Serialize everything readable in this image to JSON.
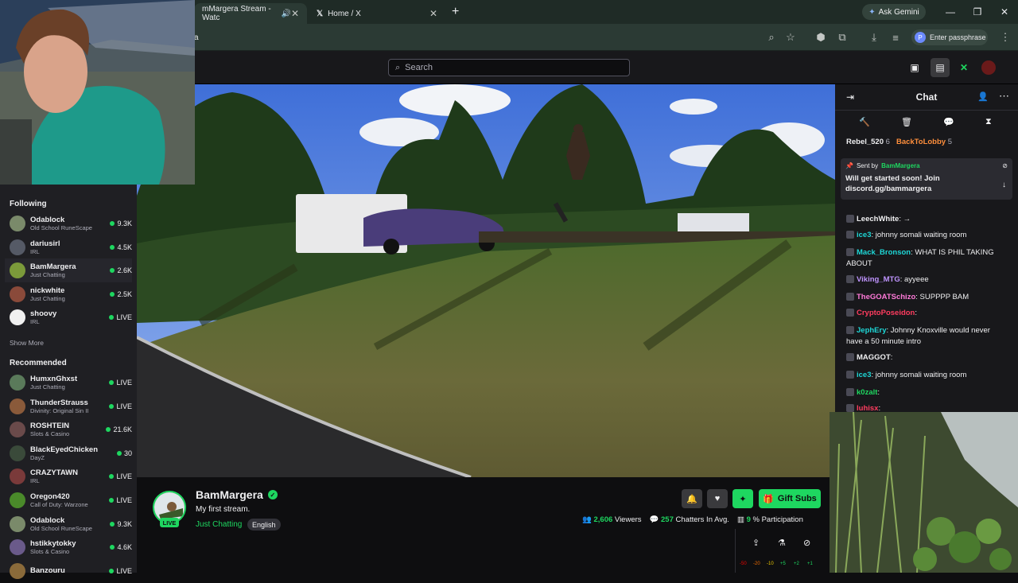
{
  "browser": {
    "tabs": [
      {
        "label": "mMargera Stream - Watc",
        "active": true
      },
      {
        "label": "Home / X",
        "active": false
      }
    ],
    "new_tab": "+",
    "gemini_label": "Ask Gemini",
    "address": "a",
    "passphrase_label": "Enter passphrase",
    "passphrase_initial": "P"
  },
  "topnav": {
    "search_placeholder": "Search"
  },
  "sidebar": {
    "following_title": "Following",
    "following": [
      {
        "name": "Odablock",
        "game": "Old School RuneScape",
        "viewers": "9.3K",
        "color": "#7a8a6a"
      },
      {
        "name": "dariusirl",
        "game": "IRL",
        "viewers": "4.5K",
        "color": "#555a66"
      },
      {
        "name": "BamMargera",
        "game": "Just Chatting",
        "viewers": "2.6K",
        "color": "#7b9a3a",
        "active": true
      },
      {
        "name": "nickwhite",
        "game": "Just Chatting",
        "viewers": "2.5K",
        "color": "#8a4a3a"
      },
      {
        "name": "shoovy",
        "game": "IRL",
        "viewers": "LIVE",
        "color": "#f0f0f0"
      }
    ],
    "show_more": "Show More",
    "recommended_title": "Recommended",
    "recommended": [
      {
        "name": "HumxnGhxst",
        "game": "Just Chatting",
        "viewers": "LIVE",
        "color": "#5a7a5a"
      },
      {
        "name": "ThunderStrauss",
        "game": "Divinity: Original Sin II",
        "viewers": "LIVE",
        "color": "#8a5a3a"
      },
      {
        "name": "ROSHTEIN",
        "game": "Slots & Casino",
        "viewers": "21.6K",
        "color": "#6a4a4a"
      },
      {
        "name": "BlackEyedChicken",
        "game": "DayZ",
        "viewers": "30",
        "color": "#3a4a3a"
      },
      {
        "name": "CRAZYTAWN",
        "game": "IRL",
        "viewers": "LIVE",
        "color": "#7a3a3a"
      },
      {
        "name": "Oregon420",
        "game": "Call of Duty: Warzone",
        "viewers": "LIVE",
        "color": "#4a8a2a"
      },
      {
        "name": "Odablock",
        "game": "Old School RuneScape",
        "viewers": "9.3K",
        "color": "#7a8a6a"
      },
      {
        "name": "hstikkytokky",
        "game": "Slots & Casino",
        "viewers": "4.6K",
        "color": "#6a5a8a"
      },
      {
        "name": "Banzouru",
        "game": "",
        "viewers": "LIVE",
        "color": "#8a6a3a"
      }
    ]
  },
  "chat": {
    "title": "Chat",
    "pinned": {
      "sent_by": "Sent by",
      "author": "BamMargera",
      "text": "Will get started soon! Join discord.gg/bammargera"
    },
    "top_gifters": [
      {
        "name": "Rebel_520",
        "count": "6"
      },
      {
        "name": "BackToLobby",
        "count": "5"
      }
    ],
    "messages": [
      {
        "user": "LeechWhite",
        "color": "#efeff1",
        "text": "→"
      },
      {
        "user": "ice3",
        "color": "#1ed7d7",
        "text": "johnny somali waiting room"
      },
      {
        "user": "Mack_Bronson",
        "color": "#1ed7d7",
        "text": "WHAT IS PHIL TAKING ABOUT"
      },
      {
        "user": "Viking_MTG",
        "color": "#bf94ff",
        "text": "ayyeee"
      },
      {
        "user": "TheGOATSchizo",
        "color": "#ff7ad9",
        "text": "SUPPPP BAM"
      },
      {
        "user": "CryptoPoseidon",
        "color": "#ff3c5f",
        "text": ""
      },
      {
        "user": "JephEry",
        "color": "#1ed7d7",
        "text": "Johnny Knoxville would never have a 50 minute intro"
      },
      {
        "user": "MAGGOT",
        "color": "#efeff1",
        "text": ""
      },
      {
        "user": "ice3",
        "color": "#1ed7d7",
        "text": "johnny somali waiting room"
      },
      {
        "user": "k0zalt",
        "color": "#1ed760",
        "text": ""
      },
      {
        "user": "luhisx",
        "color": "#ff3c5f",
        "text": ""
      }
    ]
  },
  "stream": {
    "channel": "BamMargera",
    "title": "My first stream.",
    "category": "Just Chatting",
    "tag": "English",
    "live_badge": "LIVE",
    "viewers": "2,606",
    "viewers_label": "Viewers",
    "chatters": "257",
    "chatters_label": "Chatters In Avg.",
    "participation": "9",
    "participation_label": "% Participation",
    "gift_label": "Gift Subs"
  },
  "meter_labels": [
    "-50",
    "-20",
    "-10",
    "+5",
    "+2",
    "+1"
  ],
  "colors": {
    "accent": "#1ed760",
    "twitch_purple": "#9147ff",
    "live_red": "#eb0400"
  }
}
